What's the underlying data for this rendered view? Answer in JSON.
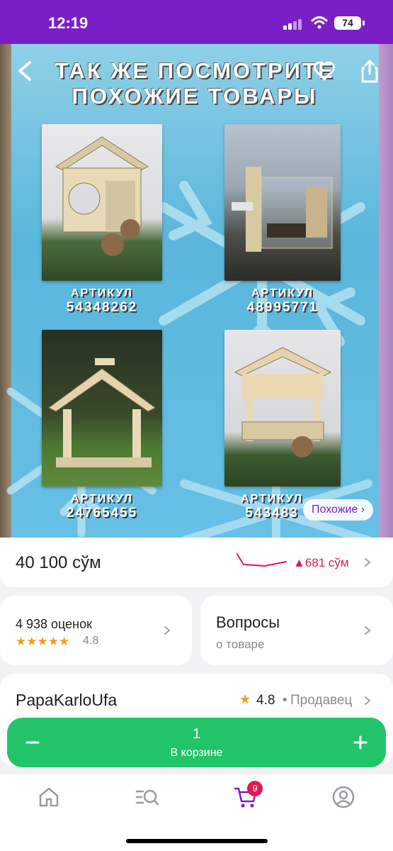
{
  "status": {
    "time": "12:19",
    "battery": "74"
  },
  "hero": {
    "title_line1": "ТАК ЖЕ ПОСМОТРИТЕ",
    "title_line2": "ПОХОЖИЕ ТОВАРЫ",
    "products": [
      {
        "label": "АРТИКУЛ",
        "sku": "54348262"
      },
      {
        "label": "АРТИКУЛ",
        "sku": "48995771"
      },
      {
        "label": "АРТИКУЛ",
        "sku": "24765455"
      },
      {
        "label": "АРТИКУЛ",
        "sku": "543483"
      }
    ],
    "similar_label": "Похожие ›"
  },
  "price": {
    "value": "40 100 сўм",
    "delta": "▲681 сўм"
  },
  "rating": {
    "reviews": "4 938 оценок",
    "stars": "★★★★★",
    "score": "4.8"
  },
  "questions": {
    "title": "Вопросы",
    "subtitle": "о товаре"
  },
  "seller": {
    "name": "PapaKarloUfa",
    "star": "★",
    "rating": "4.8",
    "separator": "•",
    "label": "Продавец"
  },
  "cart": {
    "quantity": "1",
    "label": "В корзине",
    "minus": "−",
    "plus": "+"
  },
  "tabbar": {
    "cart_badge": "9"
  },
  "colors": {
    "brand": "#7a1fc7",
    "accent_green": "#22c46a",
    "price_up": "#e3194f",
    "star": "#f39a1e"
  }
}
